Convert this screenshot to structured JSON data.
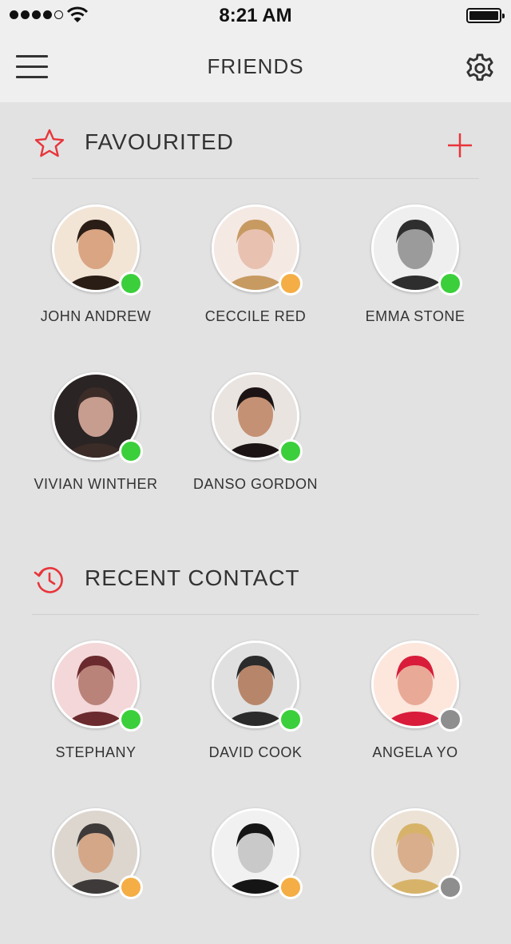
{
  "status_bar": {
    "time": "8:21 AM",
    "signal_bars": 4,
    "battery_level": 1.0
  },
  "nav": {
    "title": "FRIENDS",
    "menu_icon": "hamburger-menu-icon",
    "settings_icon": "gear-icon"
  },
  "colors": {
    "accent": "#e8353b",
    "online": "#3ccf3c",
    "away": "#f4ae45",
    "offline": "#8e8e8e"
  },
  "sections": [
    {
      "title": "FAVOURITED",
      "icon": "star-icon",
      "action_icon": "plus-icon",
      "contacts": [
        {
          "name": "JOHN ANDREW",
          "status": "online"
        },
        {
          "name": "CECCILE RED",
          "status": "away"
        },
        {
          "name": "EMMA STONE",
          "status": "online"
        },
        {
          "name": "VIVIAN WINTHER",
          "status": "online"
        },
        {
          "name": "DANSO GORDON",
          "status": "online"
        }
      ]
    },
    {
      "title": "RECENT CONTACT",
      "icon": "history-icon",
      "contacts": [
        {
          "name": "STEPHANY",
          "status": "online"
        },
        {
          "name": "DAVID COOK",
          "status": "online"
        },
        {
          "name": "ANGELA YO",
          "status": "offline"
        },
        {
          "name": "",
          "status": "away"
        },
        {
          "name": "",
          "status": "away"
        },
        {
          "name": "",
          "status": "offline"
        }
      ]
    }
  ]
}
